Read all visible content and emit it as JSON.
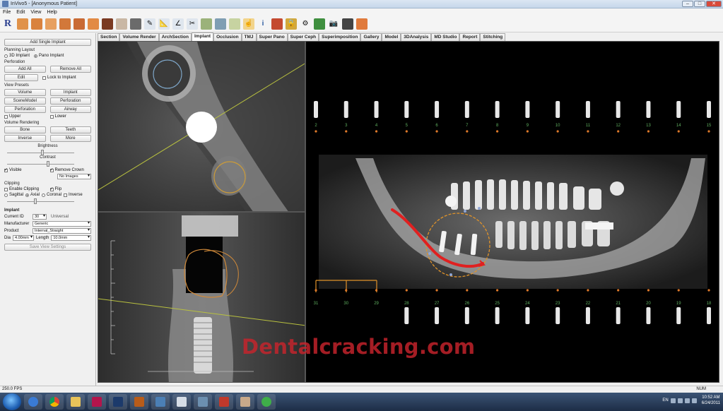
{
  "window": {
    "title": "InVivo5 - [Anonymous Patient]",
    "min": "–",
    "max": "□",
    "close": "✕"
  },
  "menu": [
    "File",
    "Edit",
    "View",
    "Help"
  ],
  "toolbar": {
    "logo": "R"
  },
  "tabs": [
    "Section",
    "Volume Render",
    "ArchSection",
    "Implant",
    "Occlusion",
    "TMJ",
    "Super Pano",
    "Super Ceph",
    "Superimposition",
    "Gallery",
    "Model",
    "3DAnalysis",
    "MD Studio",
    "Report",
    "Stitching"
  ],
  "active_tab": "Implant",
  "left": {
    "add_button": "Add Single Implant",
    "planning_layout_label": "Planning Layout",
    "layout_3d": "3D Implant",
    "layout_pano": "Pano Implant",
    "perforation_label": "Perforation",
    "add_all": "Add All",
    "remove_all": "Remove All",
    "edit": "Edit",
    "lock_to_implant": "Lock to Implant",
    "view_presets_label": "View Presets",
    "volume": "Volume",
    "implant": "Implant",
    "scene_model": "SceneModel",
    "perforation": "Perforation",
    "perforation2": "Perforation",
    "airway": "Airway",
    "upper": "Upper",
    "lower": "Lower",
    "volume_rendering_label": "Volume Rendering",
    "bone": "Bone",
    "teeth": "Teeth",
    "inverse": "Inverse",
    "more": "More",
    "brightness": "Brightness",
    "contrast": "Contrast",
    "visible": "Visible",
    "remove_crown": "Remove Crown",
    "no_images": "No Images",
    "clipping_label": "Clipping",
    "enable_clipping": "Enable Clipping",
    "flip": "Flip",
    "sagittal": "Sagittal",
    "axial": "Axial",
    "coronal": "Coronal",
    "inverse2": "Inverse",
    "implant_section": "Implant",
    "current_id_label": "Current ID",
    "current_id_value": "30",
    "universal": "Universal",
    "manufacturer_label": "Manufacturer",
    "manufacturer_value": "Generic",
    "product_label": "Product",
    "product_value": "Internal_Straight",
    "dia_label": "Dia",
    "dia_value": "4.00mm",
    "length_label": "Length",
    "length_value": "10.0mm",
    "save_settings": "Save View Settings"
  },
  "pano": {
    "upper_numbers": [
      "2",
      "3",
      "4",
      "5",
      "6",
      "7",
      "8",
      "9",
      "10",
      "11",
      "12",
      "13",
      "14",
      "15"
    ],
    "lower_numbers": [
      "31",
      "30",
      "29",
      "28",
      "27",
      "26",
      "25",
      "24",
      "23",
      "22",
      "21",
      "20",
      "19",
      "18"
    ]
  },
  "watermark": "Dentalcracking.com",
  "status": {
    "left": "250.0 FPS",
    "right": "NUM"
  },
  "taskbar": {
    "clock_time": "10:52 AM",
    "clock_date": "6/24/2011",
    "lang": "EN"
  },
  "colors": {
    "nerve": "#e02020",
    "circle": "#e0932a",
    "guide": "#c9d24a",
    "bracket": "#e0922a",
    "tooth_number": "#5fae5f"
  }
}
